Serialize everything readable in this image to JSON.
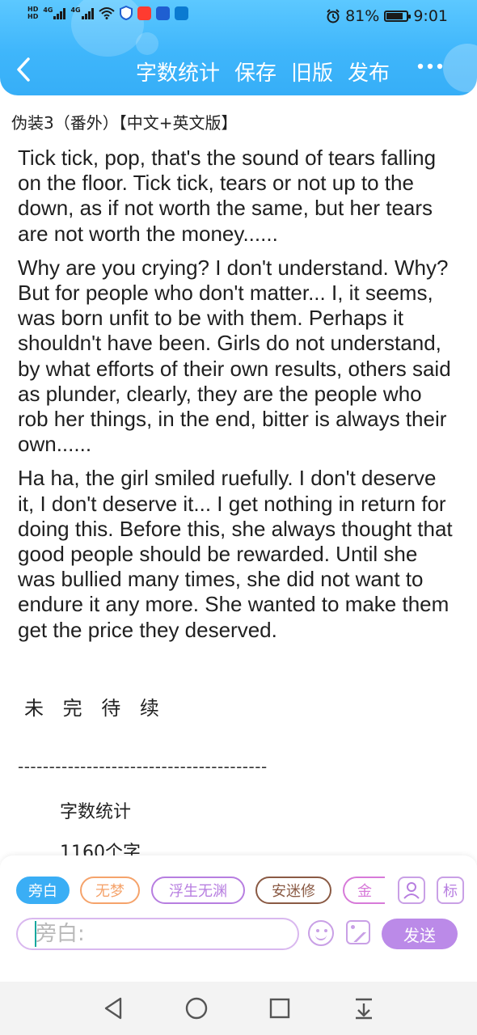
{
  "status_bar": {
    "hd_labels": [
      "HD",
      "HD"
    ],
    "signal_labels": [
      "4G",
      "4G"
    ],
    "battery_percent": "81%",
    "battery_level": 0.81,
    "time": "9:01",
    "app_icon_colors": [
      "#ff3b30",
      "#1f5fd1",
      "#0b7ad1"
    ]
  },
  "header": {
    "back_icon": "chevron-left-icon",
    "actions": {
      "word_count": "字数统计",
      "save": "保存",
      "old_version": "旧版",
      "publish": "发布"
    },
    "more_icon": "more-dots-icon",
    "gradient_colors": [
      "#5cc8ff",
      "#36aef7"
    ]
  },
  "document": {
    "title": "伪装3（番外）【中文+英文版】",
    "paragraphs": [
      " Tick tick, pop, that's the sound of tears falling on the floor. Tick tick, tears or not up to the down, as if not worth the same, but her tears are not worth the money......",
      " Why are you crying? I don't understand. Why? But for people who don't matter... I, it seems, was born unfit to be with them. Perhaps it shouldn't have been. Girls do not understand, by what efforts of their own results, others said as plunder, clearly, they are the people who rob her things, in the end, bitter is always their own......",
      " Ha ha, the girl smiled ruefully. I don't deserve it, I don't deserve it... I get nothing in return for doing this. Before this, she always thought that good people should be rewarded. Until she was bullied many times, she did not want to endure it any more. She wanted to make them get the price they deserved."
    ],
    "unfinished": "未 完 待 续",
    "divider": "----------------------------------------",
    "stats_label": "字数统计",
    "stats_count": "1160个字"
  },
  "composer": {
    "chips": [
      {
        "label": "旁白",
        "color": "#3aaef5",
        "selected": true
      },
      {
        "label": "无梦",
        "color": "#f5a36b",
        "selected": false
      },
      {
        "label": "浮生无渊",
        "color": "#b77ee0",
        "selected": false
      },
      {
        "label": "安迷修",
        "color": "#8a5a44",
        "selected": false
      },
      {
        "label": "金",
        "color": "#d77ad9",
        "selected": false
      }
    ],
    "character_icon": "person-icon",
    "mark_label": "标",
    "input_placeholder": "旁白:",
    "emoji_icon": "smiley-icon",
    "image_icon": "image-icon",
    "send_label": "发送",
    "accent_color": "#bb8ae8"
  },
  "nav_bar": {
    "icons": [
      "back-triangle-icon",
      "home-circle-icon",
      "recents-square-icon",
      "menu-down-icon"
    ]
  }
}
